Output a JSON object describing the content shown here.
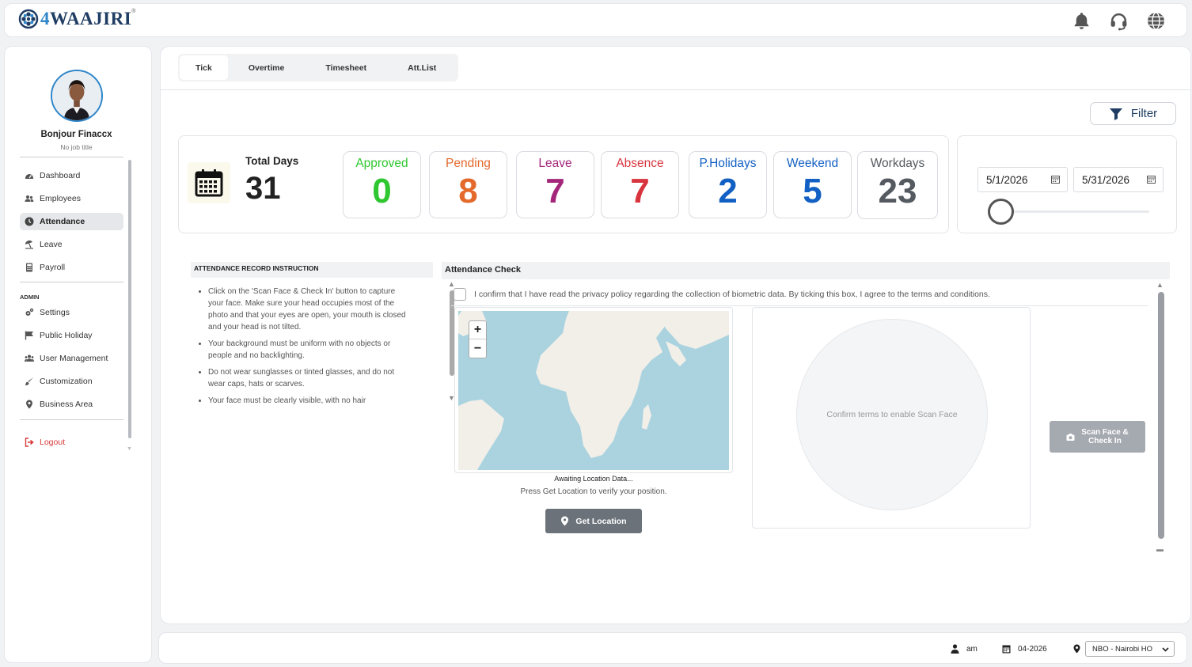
{
  "app": {
    "logo_prefix": "4",
    "logo_name": "WAAJIRI",
    "logo_tm": "®"
  },
  "topbar": {
    "icons": [
      "bell-icon",
      "headset-icon",
      "globe-icon"
    ]
  },
  "user": {
    "name": "Bonjour Finaccx",
    "title": "No job title"
  },
  "sidebar": {
    "items": [
      {
        "label": "Dashboard",
        "icon": "dashboard-icon"
      },
      {
        "label": "Employees",
        "icon": "users-icon"
      },
      {
        "label": "Attendance",
        "icon": "clock-icon",
        "active": true
      },
      {
        "label": "Leave",
        "icon": "beach-umbrella-icon"
      },
      {
        "label": "Payroll",
        "icon": "calculator-icon"
      }
    ],
    "admin_label": "ADMIN",
    "admin_items": [
      {
        "label": "Settings",
        "icon": "cogs-icon"
      },
      {
        "label": "Public Holiday",
        "icon": "flag-icon"
      },
      {
        "label": "User Management",
        "icon": "users-icon"
      },
      {
        "label": "Customization",
        "icon": "brush-icon"
      },
      {
        "label": "Business Area",
        "icon": "location-pin-icon"
      }
    ],
    "logout_label": "Logout"
  },
  "tabs": [
    {
      "label": "Tick",
      "active": true
    },
    {
      "label": "Overtime"
    },
    {
      "label": "Timesheet"
    },
    {
      "label": "Att.List"
    }
  ],
  "filter_label": "Filter",
  "stats": {
    "total_label": "Total Days",
    "total_value": "31",
    "boxes": [
      {
        "label": "Approved",
        "value": "0",
        "color": "#2fc72f"
      },
      {
        "label": "Pending",
        "value": "8",
        "color": "#e46a2c"
      },
      {
        "label": "Leave",
        "value": "7",
        "color": "#a3267a"
      },
      {
        "label": "Absence",
        "value": "7",
        "color": "#d8343e"
      },
      {
        "label": "P.Holidays",
        "value": "2",
        "color": "#1360c4"
      },
      {
        "label": "Weekend",
        "value": "5",
        "color": "#1360c4"
      },
      {
        "label": "Workdays",
        "value": "23",
        "color": "#555a60"
      }
    ]
  },
  "date_range": {
    "start": "5/1/2026",
    "end": "5/31/2026",
    "slider_value": 0
  },
  "instructions": {
    "title": "ATTENDANCE RECORD INSTRUCTION",
    "items": [
      "Click on the 'Scan Face & Check In' button to capture your face. Make sure your head occupies most of the photo and that your eyes are open, your mouth is closed and your head is not tilted.",
      "Your background must be uniform with no objects or people and no backlighting.",
      "Do not wear sunglasses or tinted glasses, and do not wear caps, hats or scarves.",
      "Your face must be clearly visible, with no hair"
    ]
  },
  "attendance_check": {
    "title": "Attendance Check",
    "consent_text": "I confirm that I have read the privacy policy regarding the collection of biometric data. By ticking this box, I agree to the terms and conditions.",
    "consent_checked": false,
    "zoom_in": "+",
    "zoom_out": "−",
    "location_status": "Awaiting Location Data...",
    "location_hint": "Press Get Location to verify your position.",
    "get_location_label": "Get Location",
    "face_placeholder": "Confirm terms to enable Scan Face",
    "scan_button_line1": "Scan Face &",
    "scan_button_line2": "Check In"
  },
  "footer": {
    "user": "am",
    "period": "04-2026",
    "branch": "NBO - Nairobi HO"
  }
}
